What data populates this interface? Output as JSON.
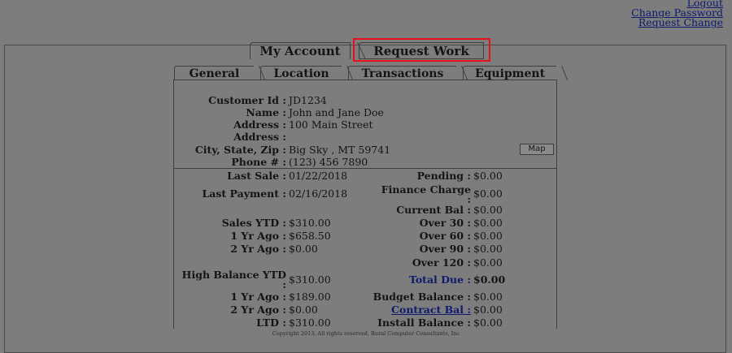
{
  "top_links": {
    "logout": "Logout",
    "change_password": "Change Password",
    "request_change": "Request Change"
  },
  "main_tabs": {
    "my_account": "My Account",
    "request_work": "Request Work"
  },
  "sub_tabs": {
    "general": "General",
    "location": "Location",
    "transactions": "Transactions",
    "equipment": "Equipment"
  },
  "customer": {
    "id_label": "Customer Id :",
    "id_value": "JD1234",
    "name_label": "Name :",
    "name_value": "John and Jane Doe",
    "address_label": "Address :",
    "address_value": "100 Main Street",
    "address2_label": "Address :",
    "address2_value": "",
    "csz_label": "City, State, Zip :",
    "csz_value": "Big Sky , MT 59741",
    "phone_label": "Phone # :",
    "phone_value": "(123) 456 7890",
    "map_button": "Map"
  },
  "left_col": {
    "last_sale_label": "Last Sale :",
    "last_sale": "01/22/2018",
    "last_payment_label": "Last Payment :",
    "last_payment": "02/16/2018",
    "sales_ytd_label": "Sales YTD :",
    "sales_ytd": "$310.00",
    "yr1_label": "1 Yr Ago :",
    "yr1": "$658.50",
    "yr2_label": "2 Yr Ago :",
    "yr2": "$0.00",
    "high_bal_label_1": "High Balance YTD",
    "high_bal_label_2": ":",
    "high_bal": "$310.00",
    "hb_yr1_label": "1 Yr Ago :",
    "hb_yr1": "$189.00",
    "hb_yr2_label": "2 Yr Ago :",
    "hb_yr2": "$0.00",
    "ltd_label": "LTD :",
    "ltd": "$310.00"
  },
  "right_col": {
    "pending_label": "Pending :",
    "pending": "$0.00",
    "finance_label_1": "Finance Charge",
    "finance_label_2": ":",
    "finance": "$0.00",
    "current_label": "Current Bal :",
    "current": "$0.00",
    "over30_label": "Over 30 :",
    "over30": "$0.00",
    "over60_label": "Over 60 :",
    "over60": "$0.00",
    "over90_label": "Over 90 :",
    "over90": "$0.00",
    "over120_label": "Over 120 :",
    "over120": "$0.00",
    "total_due_label": "Total Due :",
    "total_due": "$0.00",
    "budget_label": "Budget Balance :",
    "budget": "$0.00",
    "contract_label": "Contract Bal :",
    "contract": "$0.00",
    "install_label": "Install Balance :",
    "install": "$0.00"
  },
  "footer": "Copyright 2013, All rights reserved, Rural Computer Consultants, Inc",
  "colors": {
    "background": "#7d7d7d",
    "highlight": "#e8111b",
    "link": "#0d1a6e"
  }
}
